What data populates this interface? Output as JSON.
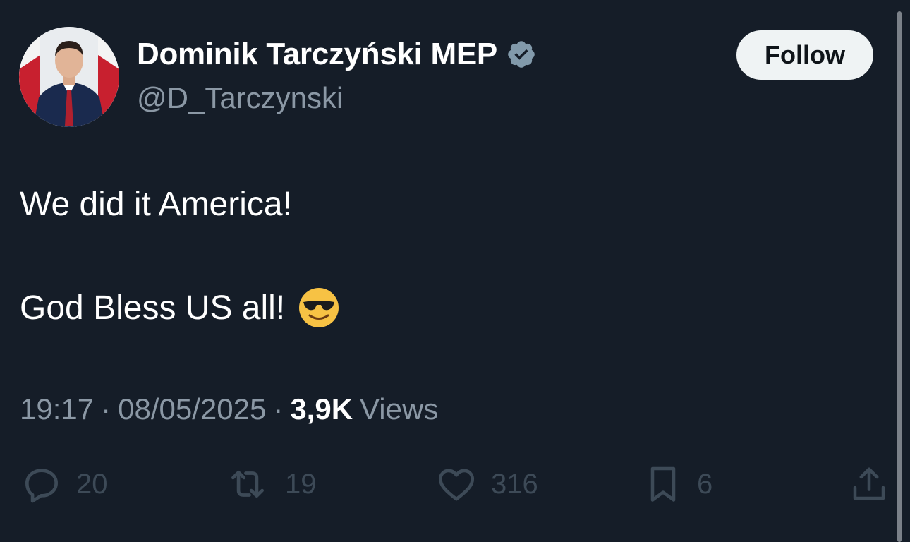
{
  "author": {
    "display_name": "Dominik Tarczyński MEP",
    "handle": "@D_Tarczynski",
    "verified_icon": "verified-badge-icon",
    "verified_color": "#829aab"
  },
  "follow_button": {
    "label": "Follow"
  },
  "tweet": {
    "line1": "We did it America!",
    "line2": "God Bless US all!",
    "emoji": "smiling-face-with-sunglasses-icon"
  },
  "meta": {
    "time": "19:17",
    "separator1": "·",
    "date": "08/05/2025",
    "separator2": "·",
    "views_count": "3,9K",
    "views_label": "Views"
  },
  "actions": {
    "replies": {
      "icon": "reply-icon",
      "count": "20"
    },
    "reposts": {
      "icon": "repost-icon",
      "count": "19"
    },
    "likes": {
      "icon": "heart-icon",
      "count": "316"
    },
    "bookmarks": {
      "icon": "bookmark-icon",
      "count": "6"
    },
    "share": {
      "icon": "share-icon"
    }
  },
  "colors": {
    "background": "#151d28",
    "text": "#ffffff",
    "muted": "#8b98a5",
    "action_icons": "#3d4a57"
  }
}
